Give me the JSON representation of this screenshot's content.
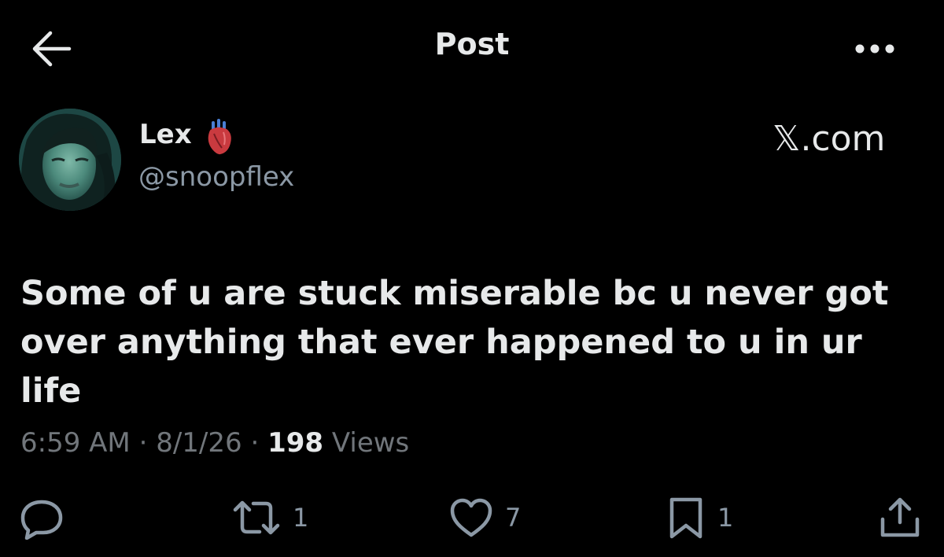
{
  "header": {
    "title": "Post",
    "back_icon": "arrow-left-icon",
    "more_icon": "more-horizontal-icon"
  },
  "author": {
    "display_name": "Lex",
    "badge_emoji": "anatomical-heart",
    "handle": "@snoopflex"
  },
  "watermark": {
    "text": "𝕏.com"
  },
  "post": {
    "text": "Some of u are stuck miserable bc u never got over anything that ever happened to u in ur life"
  },
  "meta": {
    "time": "6:59 AM",
    "separator": "·",
    "date": "8/1/26",
    "views_count": "198",
    "views_label": "Views"
  },
  "actions": {
    "reply": {
      "icon": "reply-bubble-icon",
      "count": ""
    },
    "repost": {
      "icon": "repost-icon",
      "count": "1"
    },
    "like": {
      "icon": "heart-icon",
      "count": "7"
    },
    "bookmark": {
      "icon": "bookmark-icon",
      "count": "1"
    },
    "share": {
      "icon": "share-icon",
      "count": ""
    }
  },
  "colors": {
    "background": "#000000",
    "primary_text": "#e7e9ea",
    "secondary_text": "#71767b",
    "icon": "#8b98a5"
  }
}
